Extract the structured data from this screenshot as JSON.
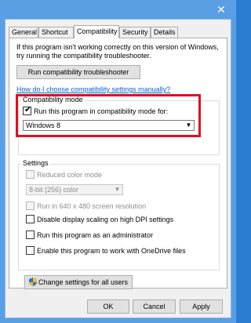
{
  "window": {
    "close_glyph": "✕"
  },
  "tabs": [
    {
      "label": "General"
    },
    {
      "label": "Shortcut"
    },
    {
      "label": "Compatibility"
    },
    {
      "label": "Security"
    },
    {
      "label": "Details"
    }
  ],
  "intro_text": "If this program isn't working correctly on this version of Windows, try running the compatibility troubleshooter.",
  "troubleshooter_button": "Run compatibility troubleshooter",
  "help_link": "How do I choose compatibility settings manually?",
  "compat_mode": {
    "group_label": "Compatibility mode",
    "checkbox_label": "Run this program in compatibility mode for:",
    "checked": true,
    "selected_os": "Windows 8"
  },
  "settings": {
    "group_label": "Settings",
    "reduced_color": {
      "label": "Reduced color mode",
      "checked": false,
      "disabled": true
    },
    "color_depth": "8-bit (256) color",
    "run_640": {
      "label": "Run in 640 x 480 screen resolution",
      "checked": false,
      "disabled": true
    },
    "disable_dpi": {
      "label": "Disable display scaling on high DPI settings",
      "checked": false
    },
    "run_admin": {
      "label": "Run this program as an administrator",
      "checked": false
    },
    "onedrive": {
      "label": "Enable this program to work with OneDrive files",
      "checked": false
    }
  },
  "change_all_button": "Change settings for all users",
  "footer": {
    "ok": "OK",
    "cancel": "Cancel",
    "apply": "Apply"
  },
  "colors": {
    "accent": "#2b7cd3",
    "highlight_box": "#e01020",
    "link": "#0066cc"
  }
}
